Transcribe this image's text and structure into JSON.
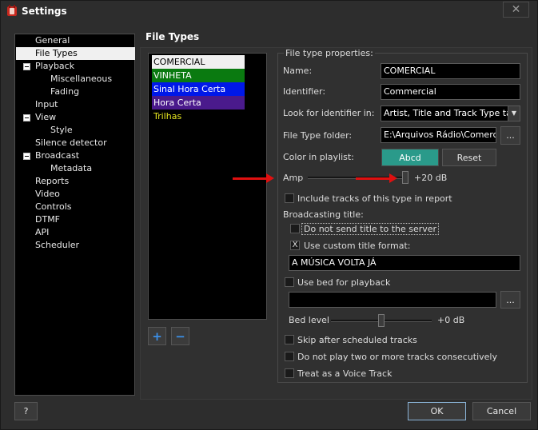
{
  "window": {
    "title": "Settings",
    "close_glyph": "✕"
  },
  "sidebar": {
    "items": [
      {
        "label": "General"
      },
      {
        "label": "File Types",
        "selected": true
      },
      {
        "label": "Playback",
        "expanded": true
      },
      {
        "label": "Miscellaneous"
      },
      {
        "label": "Fading"
      },
      {
        "label": "Input"
      },
      {
        "label": "View",
        "expanded": true
      },
      {
        "label": "Style"
      },
      {
        "label": "Silence detector"
      },
      {
        "label": "Broadcast",
        "expanded": true
      },
      {
        "label": "Metadata"
      },
      {
        "label": "Reports"
      },
      {
        "label": "Video"
      },
      {
        "label": "Controls"
      },
      {
        "label": "DTMF"
      },
      {
        "label": "API"
      },
      {
        "label": "Scheduler"
      }
    ]
  },
  "main": {
    "title": "File Types",
    "file_types": [
      {
        "label": "COMERCIAL",
        "bg": "#f0f0f0",
        "fg": "#000000"
      },
      {
        "label": "VINHETA",
        "bg": "#0a7a10",
        "fg": "#ffffff"
      },
      {
        "label": "Sinal Hora Certa",
        "bg": "#0018e8",
        "fg": "#ffffff"
      },
      {
        "label": "Hora Certa",
        "bg": "#4a1a8c",
        "fg": "#ffffff"
      },
      {
        "label": "Trilhas",
        "bg": "#000000",
        "fg": "#e8e820"
      }
    ],
    "add_glyph": "+",
    "remove_glyph": "−"
  },
  "props": {
    "legend": "File type properties:",
    "name_label": "Name:",
    "name_value": "COMERCIAL",
    "identifier_label": "Identifier:",
    "identifier_value": "Commercial",
    "look_label": "Look for identifier in:",
    "look_value": "Artist, Title and Track Type tag",
    "folder_label": "File Type folder:",
    "folder_value": "E:\\Arquivos Rádio\\Comercia",
    "browse_label": "...",
    "color_label": "Color in playlist:",
    "color_sample": "Abcd",
    "color_sample_bg": "#2a9a8a",
    "reset_label": "Reset",
    "amp_label": "Amp",
    "amp_value": "+20 dB",
    "amp_level": 1.0,
    "include_reports_label": "Include tracks of this type in report",
    "include_reports_checked": false,
    "broadcasting_title_label": "Broadcasting title:",
    "no_send_label": "Do not send title to the server",
    "no_send_checked": false,
    "custom_title_label": "Use custom title format:",
    "custom_title_checked": true,
    "custom_title_value": "A MÚSICA VOLTA JÁ",
    "use_bed_label": "Use bed for playback",
    "use_bed_checked": false,
    "bed_file_value": "",
    "bed_browse_label": "...",
    "bed_level_label": "Bed level",
    "bed_level_value": "+0 dB",
    "bed_level_level": 0.5,
    "skip_label": "Skip after scheduled tracks",
    "skip_checked": false,
    "no_consecutive_label": "Do not play two or more tracks consecutively",
    "no_consecutive_checked": false,
    "voice_track_label": "Treat as a Voice Track",
    "voice_track_checked": false,
    "check_glyph": "X"
  },
  "footer": {
    "help_label": "?",
    "ok_label": "OK",
    "cancel_label": "Cancel"
  },
  "colors": {
    "arrow": "#e01010",
    "selection": "#f0f0f0",
    "accent_blue": "#3b8fe8"
  }
}
